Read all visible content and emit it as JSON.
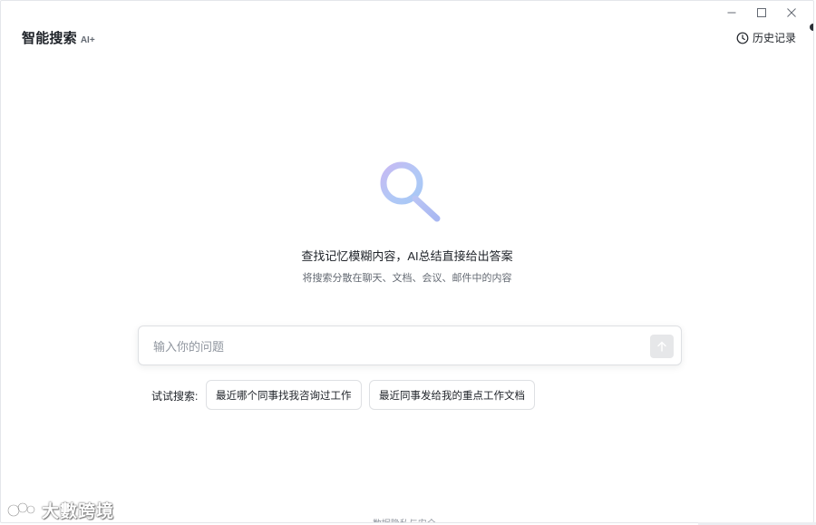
{
  "header": {
    "title": "智能搜索",
    "ai_badge": "AI+",
    "history_label": "历史记录"
  },
  "window_controls": [
    "minimize-icon",
    "maximize-icon",
    "close-icon"
  ],
  "hero": {
    "icon": "search-icon",
    "title": "查找记忆模糊内容，AI总结直接给出答案",
    "subtitle": "将搜索分散在聊天、文档、会议、邮件中的内容"
  },
  "search": {
    "placeholder": "输入你的问题",
    "value": ""
  },
  "suggestions": {
    "label": "试试搜索:",
    "items": [
      "最近哪个同事找我咨询过工作",
      "最近同事发给我的重点工作文档"
    ]
  },
  "footer": {
    "privacy_link": "数据隐私与安全 ›"
  },
  "watermark": {
    "text": "大數跨境"
  },
  "colors": {
    "text_primary": "#1f2329",
    "text_secondary": "#646a73",
    "border": "#dee0e3",
    "icon_gradient_start": "#a9c6f5",
    "icon_gradient_end": "#c9b8f2"
  }
}
